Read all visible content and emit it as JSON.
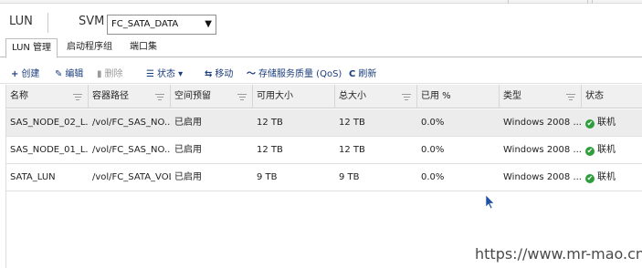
{
  "header": {
    "title": "LUN",
    "svm_label": "SVM",
    "svm_selected": "FC_SATA_DATA",
    "caret": "▼"
  },
  "tabs": [
    {
      "label": "LUN 管理",
      "active": true
    },
    {
      "label": "启动程序组",
      "active": false
    },
    {
      "label": "端口集",
      "active": false
    }
  ],
  "toolbar": {
    "create": {
      "icon": "+",
      "label": "创建"
    },
    "edit": {
      "icon": "✎",
      "label": "编辑"
    },
    "delete": {
      "icon": "▮",
      "label": "删除"
    },
    "status": {
      "icon": "☰",
      "label": "状态 ▾"
    },
    "move": {
      "icon": "⇆",
      "label": "移动"
    },
    "qos": {
      "icon": "〜",
      "label": "存储服务质量 (QoS)"
    },
    "refresh": {
      "icon": "C",
      "label": "刷新"
    }
  },
  "table": {
    "columns": [
      "名称",
      "容器路径",
      "空间预留",
      "可用大小",
      "总大小",
      "已用 %",
      "类型",
      "状态"
    ],
    "rows": [
      [
        "SAS_NODE_02_L...",
        "/vol/FC_SAS_NO...",
        "已启用",
        "12 TB",
        "12 TB",
        "0.0%",
        "Windows 2008 ...",
        "联机"
      ],
      [
        "SAS_NODE_01_L...",
        "/vol/FC_SAS_NO...",
        "已启用",
        "12 TB",
        "12 TB",
        "0.0%",
        "Windows 2008 ...",
        "联机"
      ],
      [
        "SATA_LUN",
        "/vol/FC_SATA_VOL",
        "已启用",
        "9 TB",
        "9 TB",
        "0.0%",
        "Windows 2008 ...",
        "联机"
      ]
    ],
    "status_icon": "✔"
  },
  "watermark": "https://www.mr-mao.cn",
  "colors": {
    "accent": "#1a3d7c",
    "online": "#2e9e3c",
    "selected_row": "#ececec"
  }
}
